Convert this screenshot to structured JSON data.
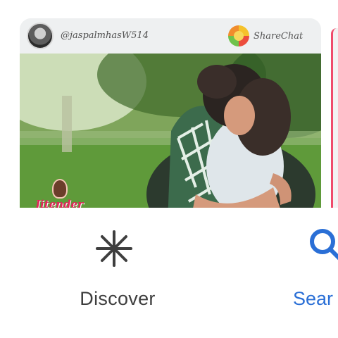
{
  "feed_card": {
    "username": "@jaspalmhasW514",
    "app_name": "ShareChat",
    "watermark_text": "Jitender",
    "avatar_icon": "user-avatar",
    "app_logo_icon": "sharechat-logo-icon"
  },
  "nav": {
    "discover_label": "Discover",
    "discover_icon": "asterisk-icon",
    "search_label": "Sear",
    "search_icon": "search-icon"
  },
  "colors": {
    "nav_active": "#2a6fd6",
    "nav_inactive": "#3e3e3e",
    "card_bg": "#eef0f1"
  }
}
